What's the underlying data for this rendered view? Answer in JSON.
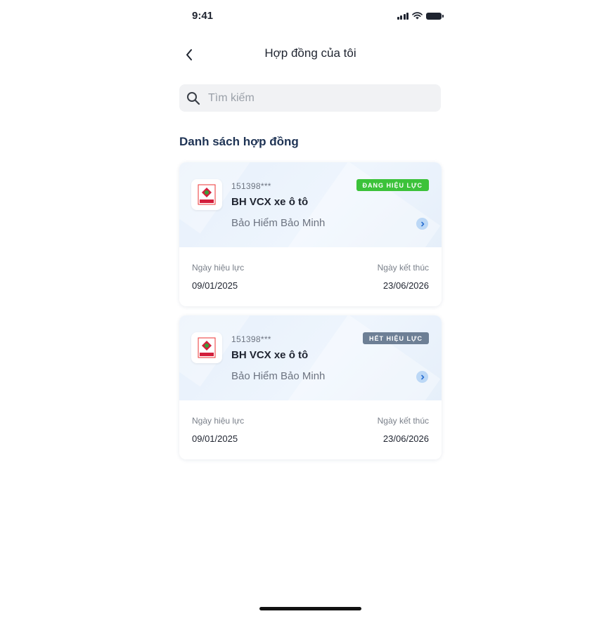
{
  "status_bar": {
    "time": "9:41",
    "icons": [
      "signal-icon",
      "wifi-icon",
      "battery-icon"
    ]
  },
  "header": {
    "back_icon": "chevron-left-icon",
    "title": "Hợp đồng của tôi"
  },
  "search": {
    "placeholder": "Tìm kiếm",
    "value": "",
    "icon": "search-icon"
  },
  "section": {
    "title": "Danh sách hợp đồng"
  },
  "contracts": [
    {
      "number": "151398***",
      "product": "BH VCX xe ô tô",
      "insurer": "Bảo Hiểm Bảo Minh",
      "status": "ĐANG HIỆU LỰC",
      "status_color": "#3cc23a",
      "start_label": "Ngày hiệu lực",
      "start_date": "09/01/2025",
      "end_label": "Ngày kết thúc",
      "end_date": "23/06/2026"
    },
    {
      "number": "151398***",
      "product": "BH VCX xe ô tô",
      "insurer": "Bảo Hiểm Bảo Minh",
      "status": "HẾT HIỆU LỰC",
      "status_color": "#6d7f95",
      "start_label": "Ngày hiệu lực",
      "start_date": "09/01/2025",
      "end_label": "Ngày kết thúc",
      "end_date": "23/06/2026"
    }
  ],
  "colors": {
    "accent": "#1e3354",
    "active": "#3cc23a",
    "expired": "#6d7f95",
    "card_bg": "#eaf2fc"
  }
}
